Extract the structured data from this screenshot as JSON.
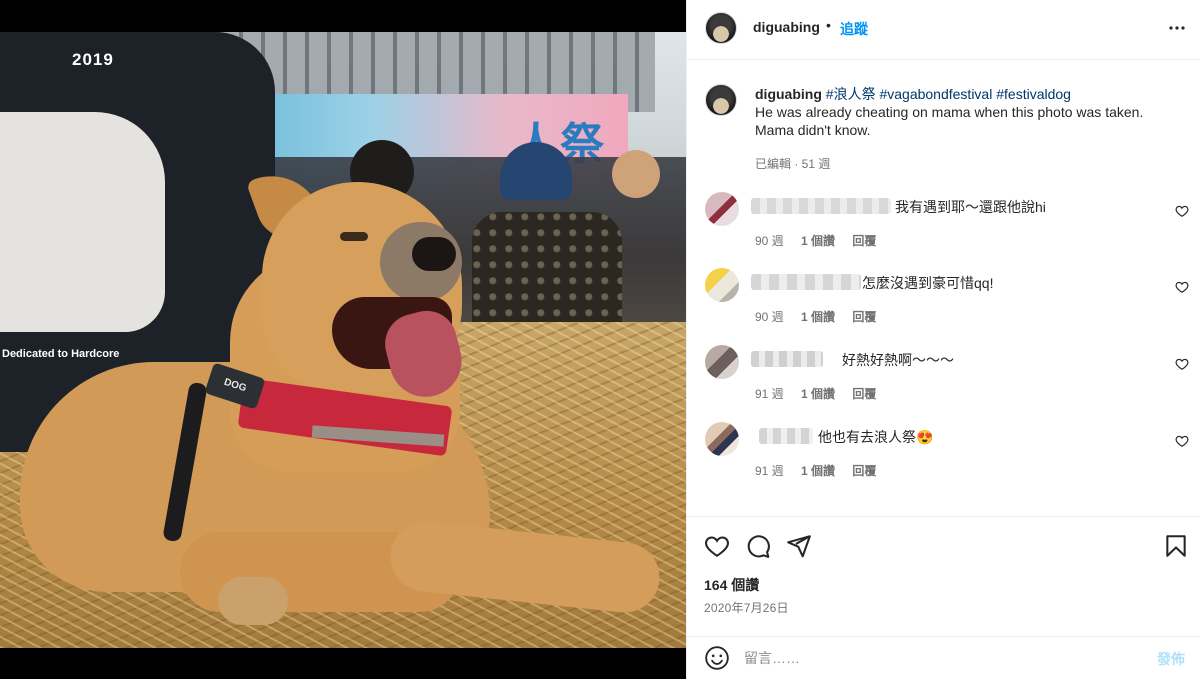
{
  "post": {
    "username": "diguabing",
    "separator": "•",
    "follow_label": "追蹤",
    "more_icon": "more-horizontal-icon"
  },
  "caption": {
    "username": "diguabing",
    "hashtags": [
      "#浪人祭",
      "#vagabondfestival",
      "#festivaldog"
    ],
    "line1": "He was already cheating on mama when this photo was taken.",
    "line2": "Mama didn't know.",
    "meta": "已編輯 · 51 週"
  },
  "photo": {
    "banner_text": "人祭",
    "shirt_year": "2019",
    "shirt_text": "Dedicated to Hardcore",
    "dog_tag": "DOG"
  },
  "comments": [
    {
      "text": "我有遇到耶～還跟他說hi",
      "age": "90 週",
      "likes": "1 個讚",
      "reply": "回覆"
    },
    {
      "text": "怎麼沒遇到豪可惜qq!",
      "age": "90 週",
      "likes": "1 個讚",
      "reply": "回覆"
    },
    {
      "text": "好熱好熱啊～～～",
      "age": "91 週",
      "likes": "1 個讚",
      "reply": "回覆"
    },
    {
      "text": "他也有去浪人祭😍",
      "age": "91 週",
      "likes": "1 個讚",
      "reply": "回覆"
    }
  ],
  "actions": {
    "like_icon": "heart-icon",
    "comment_icon": "comment-icon",
    "share_icon": "share-icon",
    "save_icon": "bookmark-icon"
  },
  "likes_count": "164 個讚",
  "post_date": "2020年7月26日",
  "composer": {
    "placeholder": "留言……",
    "post_label": "發佈",
    "emoji_icon": "emoji-icon"
  },
  "colors": {
    "link_blue": "#0095f6",
    "hashtag": "#00376b",
    "muted": "#737373",
    "post_disabled": "#b2dffc"
  }
}
